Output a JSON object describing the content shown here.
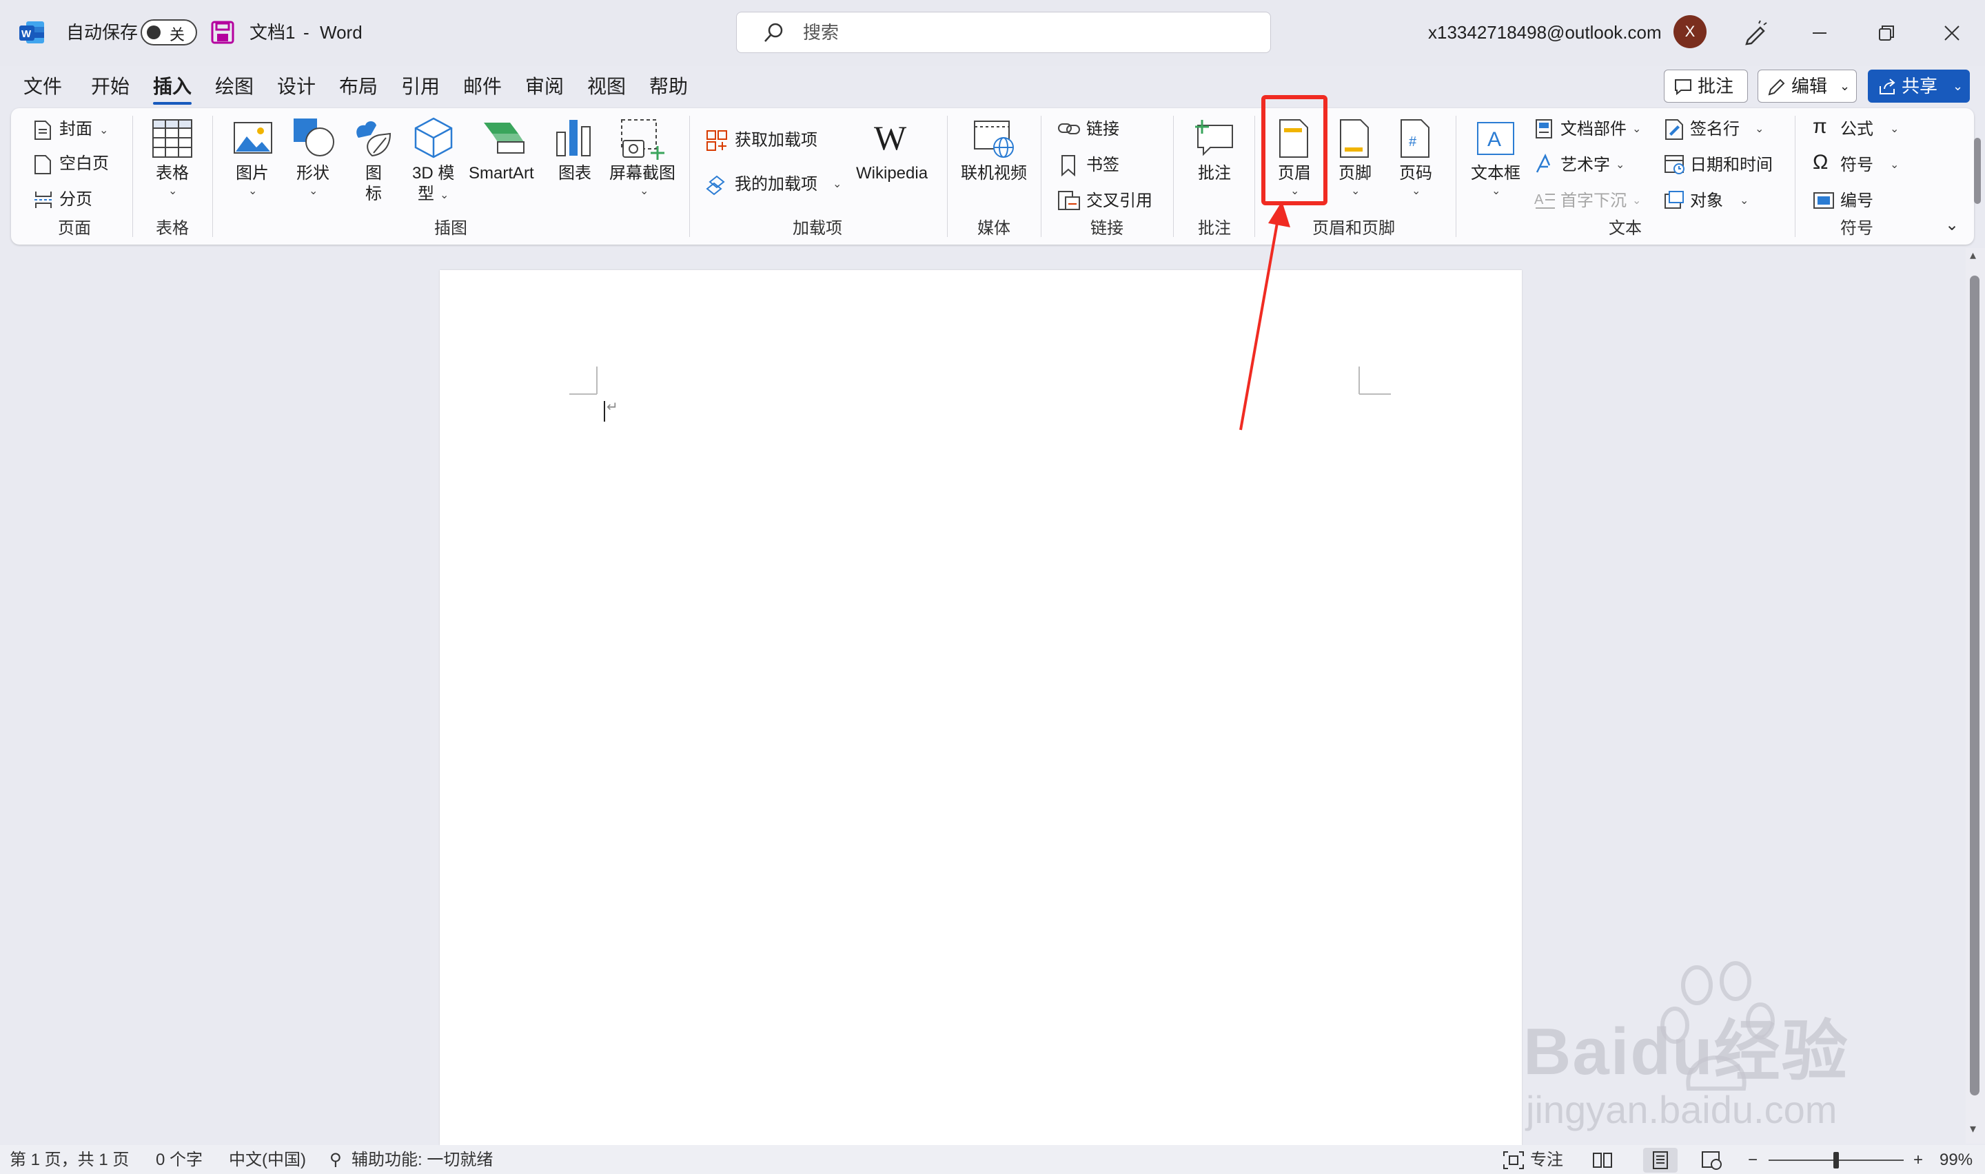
{
  "titlebar": {
    "autosave_label": "自动保存",
    "autosave_state": "关",
    "doc_title": "文档1",
    "separator": "-",
    "app_name": "Word",
    "search_placeholder": "搜索",
    "account_email": "x13342718498@outlook.com",
    "avatar_initial": "X"
  },
  "menu": {
    "items": [
      "文件",
      "开始",
      "插入",
      "绘图",
      "设计",
      "布局",
      "引用",
      "邮件",
      "审阅",
      "视图",
      "帮助"
    ],
    "active": "插入",
    "comments_button": "批注",
    "editing_button": "编辑",
    "share_button": "共享"
  },
  "ribbon": {
    "pages": {
      "cover": "封面",
      "blank_page": "空白页",
      "page_break": "分页",
      "group": "页面"
    },
    "tables": {
      "table": "表格",
      "group": "表格"
    },
    "illustrations": {
      "pictures": "图片",
      "shapes": "形状",
      "icons_line1": "图",
      "icons_line2": "标",
      "model_line1": "3D 模",
      "model_line2": "型",
      "smartart": "SmartArt",
      "chart": "图表",
      "screenshot": "屏幕截图",
      "group": "插图"
    },
    "addins": {
      "get_addins": "获取加载项",
      "my_addins": "我的加载项",
      "wikipedia": "Wikipedia",
      "wikipedia_logo": "W",
      "group": "加载项"
    },
    "media": {
      "online_video": "联机视频",
      "group": "媒体"
    },
    "links": {
      "link": "链接",
      "bookmark": "书签",
      "cross_reference": "交叉引用",
      "group": "链接"
    },
    "comments": {
      "comment": "批注",
      "group": "批注"
    },
    "header_footer": {
      "header": "页眉",
      "footer": "页脚",
      "page_number": "页码",
      "group": "页眉和页脚"
    },
    "text": {
      "text_box": "文本框",
      "quick_parts": "文档部件",
      "wordart": "艺术字",
      "drop_cap": "首字下沉",
      "signature_line": "签名行",
      "date_time": "日期和时间",
      "object": "对象",
      "group": "文本"
    },
    "symbols": {
      "equation": "公式",
      "symbol": "符号",
      "number": "编号",
      "group": "符号"
    }
  },
  "statusbar": {
    "page_info": "第 1 页，共 1 页",
    "word_count": "0 个字",
    "language": "中文(中国)",
    "accessibility": "辅助功能: 一切就绪",
    "focus": "专注",
    "zoom_minus": "−",
    "zoom_plus": "+",
    "zoom_level": "99%",
    "zoom_fraction": 0.5
  },
  "watermark": {
    "brand": "Baidu经验",
    "url": "jingyan.baidu.com"
  },
  "colors": {
    "accent": "#185abd",
    "annotation": "#f02b22",
    "title_bg": "#e8e9f0",
    "page_bg": "#ffffff"
  }
}
